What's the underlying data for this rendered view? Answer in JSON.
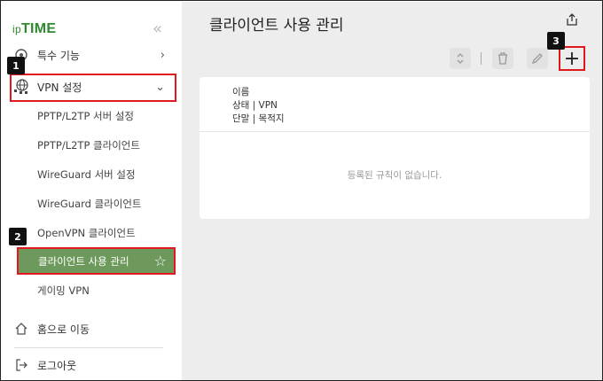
{
  "brand": {
    "prefix": "ip",
    "name": "TIME",
    "color": "#2f8a2f"
  },
  "sidebar": {
    "collapse_glyph": "«",
    "items": [
      {
        "label": "특수 기능",
        "icon": "gear-icon"
      },
      {
        "label": "VPN 설정",
        "icon": "globe-network-icon"
      }
    ],
    "sub_items": [
      {
        "label": "PPTP/L2TP 서버 설정"
      },
      {
        "label": "PPTP/L2TP 클라이언트"
      },
      {
        "label": "WireGuard 서버 설정"
      },
      {
        "label": "WireGuard 클라이언트"
      },
      {
        "label": "OpenVPN 클라이언트"
      },
      {
        "label": "클라이언트 사용 관리"
      },
      {
        "label": "게이밍 VPN"
      }
    ],
    "footer": [
      {
        "label": "홈으로 이동",
        "icon": "home-icon"
      },
      {
        "label": "로그아웃",
        "icon": "logout-icon"
      }
    ],
    "active_color": "#6d9a5c"
  },
  "badges": {
    "b1": "1",
    "b2": "2",
    "b3": "3"
  },
  "main": {
    "title": "클라이언트 사용 관리",
    "add_glyph": "+",
    "table": {
      "header_lines": [
        "이름",
        "상태 | VPN",
        "단말 | 목적지"
      ],
      "empty_message": "등록된 규칙이 없습니다."
    }
  },
  "colors": {
    "highlight_border": "#e0191e",
    "main_bg": "#ededed"
  }
}
